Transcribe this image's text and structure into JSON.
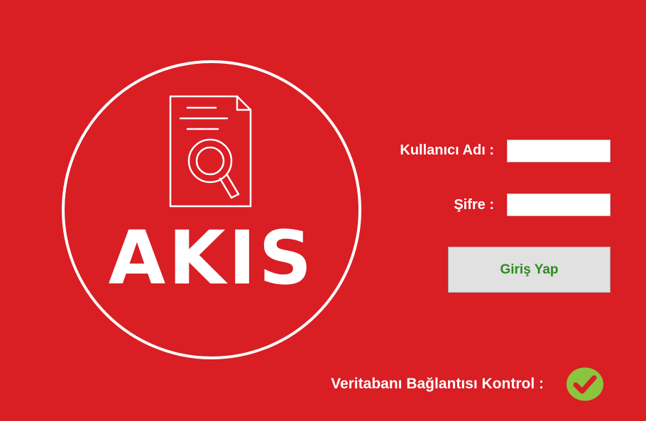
{
  "logo": {
    "brand_text": "AKIS",
    "icon": "document-search-icon"
  },
  "login_form": {
    "username_label": "Kullanıcı Adı :",
    "username_value": "",
    "password_label": "Şifre :",
    "password_value": "",
    "submit_label": "Giriş Yap"
  },
  "db_check": {
    "label": "Veritabanı Bağlantısı Kontrol :",
    "status_icon": "check-circle-icon",
    "status": "connected"
  },
  "colors": {
    "background": "#d91e24",
    "foreground": "#ffffff",
    "button_bg": "#e1e1e1",
    "button_text": "#2e8b1e",
    "status_ok": "#8bc53f"
  }
}
